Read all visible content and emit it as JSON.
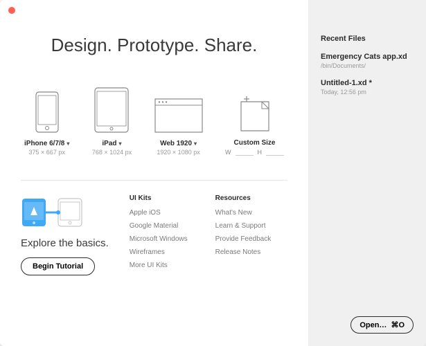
{
  "headline": "Design. Prototype. Share.",
  "templates": [
    {
      "key": "iphone",
      "label": "iPhone 6/7/8",
      "dim": "375 × 667 px",
      "hasChevron": true
    },
    {
      "key": "ipad",
      "label": "iPad",
      "dim": "768 × 1024 px",
      "hasChevron": true
    },
    {
      "key": "web",
      "label": "Web 1920",
      "dim": "1920 × 1080 px",
      "hasChevron": true
    },
    {
      "key": "custom",
      "label": "Custom Size",
      "hasChevron": false
    }
  ],
  "customInputs": {
    "wLabel": "W",
    "hLabel": "H"
  },
  "tutorial": {
    "text": "Explore the basics.",
    "button": "Begin Tutorial"
  },
  "linkCols": [
    {
      "head": "UI Kits",
      "items": [
        "Apple iOS",
        "Google Material",
        "Microsoft Windows",
        "Wireframes",
        "More UI Kits"
      ]
    },
    {
      "head": "Resources",
      "items": [
        "What's New",
        "Learn & Support",
        "Provide Feedback",
        "Release Notes"
      ]
    }
  ],
  "sidebar": {
    "head": "Recent Files",
    "recents": [
      {
        "name": "Emergency Cats app.xd",
        "path": "/bin/Documents/"
      },
      {
        "name": "Untitled-1.xd *",
        "path": "Today, 12:56 pm"
      }
    ],
    "openLabel": "Open…",
    "openShortcut": "⌘O"
  }
}
